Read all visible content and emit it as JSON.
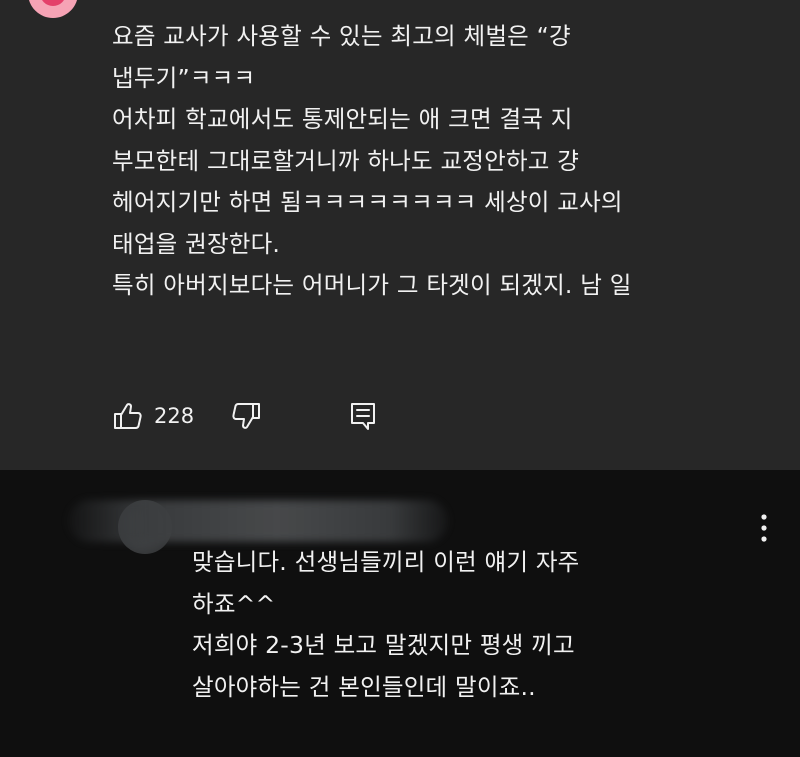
{
  "comment": {
    "lines": [
      "요즘 교사가 사용할 수 있는 최고의 체벌은 “걍",
      "냅두기”ㅋㅋㅋ",
      "어차피 학교에서도 통제안되는 애 크면 결국 지",
      "부모한테 그대로할거니까 하나도 교정안하고 걍",
      "헤어지기만 하면 됨ㅋㅋㅋㅋㅋㅋㅋㅋ 세상이 교사의",
      "태업을 권장한다.",
      "특히 아버지보다는 어머니가 그 타겟이 되겠지. 남 일"
    ],
    "like_count": "228",
    "icons": {
      "like": "thumbs-up-icon",
      "dislike": "thumbs-down-icon",
      "reply": "reply-icon"
    }
  },
  "reply": {
    "lines": [
      "맞습니다. 선생님들끼리 이런 얘기 자주",
      "하죠^^",
      "저희야 2-3년 보고 말겠지만 평생 끼고",
      "살아야하는 건 본인들인데 말이죠.."
    ],
    "icons": {
      "more": "more-vertical-icon"
    }
  },
  "colors": {
    "top_background": "#272727",
    "reply_background": "#0f0f0f",
    "text": "#f1f1f1",
    "avatar_pink": "#f6a3b5"
  }
}
